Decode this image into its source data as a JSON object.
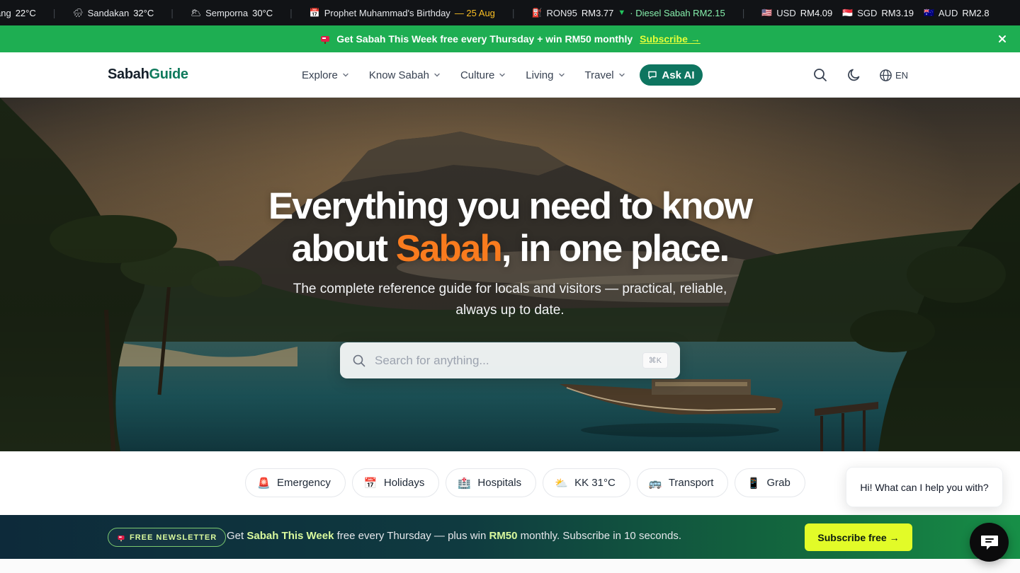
{
  "ticker": {
    "items": [
      {
        "glyph": "",
        "label": "ang",
        "value": "22°C"
      },
      {
        "glyph": "🌧",
        "label": "Sandakan",
        "value": "32°C"
      },
      {
        "glyph": "🌥",
        "label": "Semporna",
        "value": "30°C"
      }
    ],
    "holiday": {
      "glyph": "📅",
      "label": "Prophet Muhammad's Birthday",
      "date": "— 25 Aug"
    },
    "fuel": {
      "glyph": "⛽",
      "label": "RON95",
      "value": "RM3.77",
      "trend": "▼",
      "diesel": "· Diesel Sabah RM2.15"
    },
    "currencies": [
      {
        "flag": "🇺🇸",
        "code": "USD",
        "value": "RM4.09"
      },
      {
        "flag": "🇸🇬",
        "code": "SGD",
        "value": "RM3.19"
      },
      {
        "flag": "🇦🇺",
        "code": "AUD",
        "value": "RM2.8"
      }
    ]
  },
  "promo": {
    "icon": "mailbox-icon",
    "text": "Get Sabah This Week free every Thursday + win RM50 monthly",
    "cta": "Subscribe →"
  },
  "header": {
    "logo_a": "Sabah",
    "logo_b": "Guide",
    "nav": [
      "Explore",
      "Know Sabah",
      "Culture",
      "Living",
      "Travel"
    ],
    "ask_ai": "Ask AI",
    "lang": "EN"
  },
  "hero": {
    "title_line1": "Everything you need to know",
    "title_pre": "about ",
    "title_highlight": "Sabah",
    "title_post": ", in one place.",
    "subtitle": "The complete reference guide for locals and visitors — practical, reliable, always up to date.",
    "search_placeholder": "Search for anything...",
    "search_shortcut": "⌘K"
  },
  "quick_links": [
    {
      "icon": "🚨",
      "label": "Emergency"
    },
    {
      "icon": "📅",
      "label": "Holidays"
    },
    {
      "icon": "🏥",
      "label": "Hospitals"
    },
    {
      "icon": "⛅",
      "label": "KK 31°C"
    },
    {
      "icon": "🚌",
      "label": "Transport"
    },
    {
      "icon": "📱",
      "label": "Grab"
    }
  ],
  "chat": {
    "greeting": "Hi! What can I help you with?"
  },
  "newsletter": {
    "badge": "FREE NEWSLETTER",
    "text_pre": "Get ",
    "text_highlight": "Sabah This Week",
    "text_mid": " free every Thursday — plus win ",
    "text_prize": "RM50",
    "text_post": " monthly. Subscribe in 10 seconds.",
    "button": "Subscribe free →"
  },
  "colors": {
    "promo_bg": "#1eae52",
    "brand_green": "#0e7560",
    "accent_orange": "#f97b1e",
    "cta_lime": "#e2fb28"
  }
}
